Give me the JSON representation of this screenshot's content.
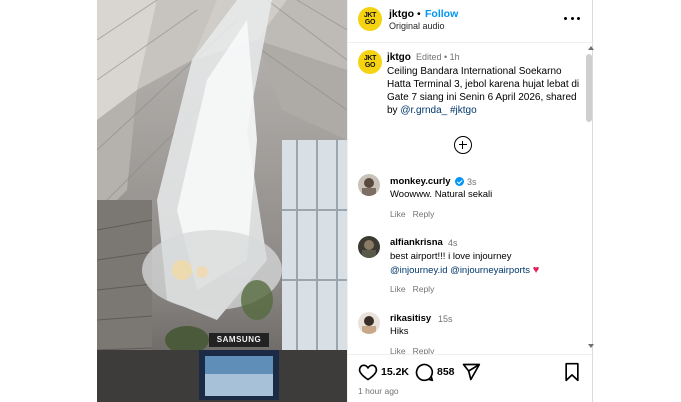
{
  "header": {
    "username": "jktgo",
    "dot": "•",
    "follow_label": "Follow",
    "audio_label": "Original audio",
    "avatar_text": "JKT GO",
    "brand_color": "#f5d310",
    "more_icon": "more-horizontal-icon"
  },
  "caption": {
    "username": "jktgo",
    "meta": "Edited • 1h",
    "text": "Ceiling Bandara International Soekarno Hatta Terminal 3, jebol karena hujat lebat di Gate 7 siang ini Senin 6 April 2026, shared by ",
    "mention1": "@r.grnda_",
    "hashtag": "#jktgo"
  },
  "load_more_icon": "plus-circle-icon",
  "comments": [
    {
      "username": "monkey.curly",
      "verified": true,
      "time": "3s",
      "text": "Woowww. Natural sekali",
      "like_label": "Like",
      "reply_label": "Reply"
    },
    {
      "username": "alfiankrisna",
      "verified": false,
      "time": "4s",
      "text": "best airport!!! i love injourney",
      "mention1": "@injourney.id",
      "mention2": "@injourneyairports",
      "emoji": "♥",
      "like_label": "Like",
      "reply_label": "Reply"
    },
    {
      "username": "rikasitisy",
      "verified": false,
      "time": "15s",
      "text": "Hiks",
      "like_label": "Like",
      "reply_label": "Reply"
    }
  ],
  "actions": {
    "likes": "15.2K",
    "comments": "858",
    "like_icon": "heart-icon",
    "comment_icon": "comment-icon",
    "share_icon": "send-icon",
    "save_icon": "bookmark-icon"
  },
  "post_time": "1 hour ago",
  "video": {
    "sign_text": "SAMSUNG"
  },
  "colors": {
    "link": "#0095f6",
    "mention": "#00376b",
    "muted": "#737373",
    "heart_red": "#e0245e"
  }
}
